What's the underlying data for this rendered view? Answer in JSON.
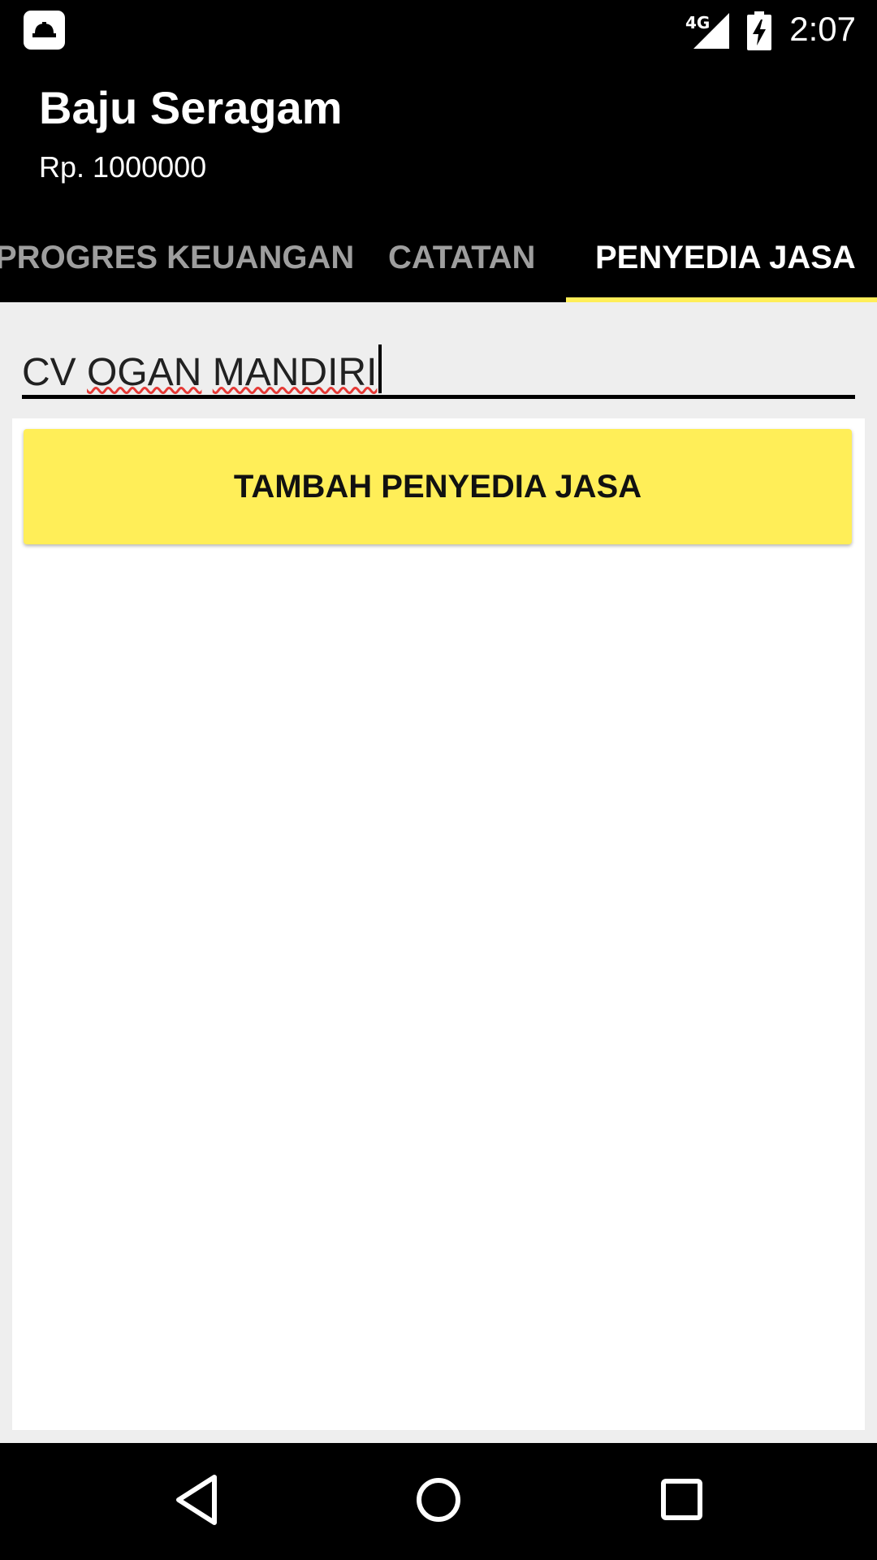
{
  "status_bar": {
    "network": "4G",
    "time": "2:07",
    "notification_icon": "hard-hat-icon"
  },
  "app_bar": {
    "title": "Baju Seragam",
    "subtitle": "Rp. 1000000"
  },
  "tabs": [
    {
      "label": "PROGRES KEUANGAN",
      "selected": false
    },
    {
      "label": "CATATAN",
      "selected": false
    },
    {
      "label": "PENYEDIA JASA",
      "selected": true
    }
  ],
  "form": {
    "provider_input": {
      "words": [
        "CV",
        "OGAN",
        "MANDIRI"
      ]
    },
    "add_button_label": "TAMBAH PENYEDIA JASA"
  },
  "navigation": {
    "back": "back-icon",
    "home": "home-icon",
    "recents": "recents-icon"
  },
  "colors": {
    "accent": "#ffee58",
    "app_bar": "#000000",
    "tab_inactive": "#9e9e9e",
    "spellcheck": "#e53935"
  }
}
